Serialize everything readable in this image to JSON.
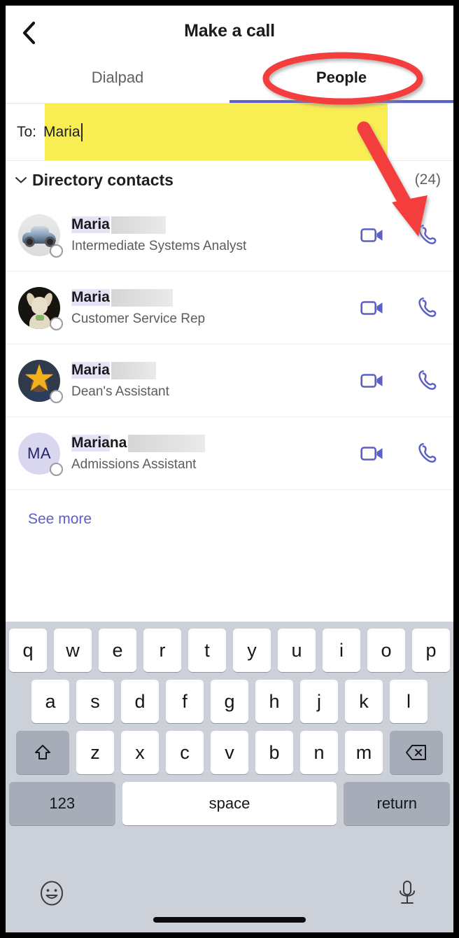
{
  "header": {
    "title": "Make a call",
    "back_icon": "chevron-left-icon"
  },
  "tabs": [
    {
      "label": "Dialpad",
      "active": false
    },
    {
      "label": "People",
      "active": true
    }
  ],
  "to_field": {
    "label": "To:",
    "value": "Maria",
    "highlight_color": "#f9ed54"
  },
  "section": {
    "title": "Directory contacts",
    "count": "(24)",
    "chevron_icon": "chevron-down-icon"
  },
  "contacts": [
    {
      "name_match": "Maria",
      "name_rest": "",
      "redacted_width": 78,
      "job_title": "Intermediate Systems Analyst",
      "avatar_type": "photo-car",
      "avatar_initials": "",
      "video_icon": "video-camera-icon",
      "call_icon": "phone-handset-icon"
    },
    {
      "name_match": "Maria",
      "name_rest": "",
      "redacted_width": 88,
      "job_title": "Customer Service Rep",
      "avatar_type": "photo-dog",
      "avatar_initials": "",
      "video_icon": "video-camera-icon",
      "call_icon": "phone-handset-icon"
    },
    {
      "name_match": "Maria",
      "name_rest": "",
      "redacted_width": 64,
      "job_title": "Dean's Assistant",
      "avatar_type": "photo-star",
      "avatar_initials": "",
      "video_icon": "video-camera-icon",
      "call_icon": "phone-handset-icon"
    },
    {
      "name_match": "Maria",
      "name_rest": "na",
      "redacted_width": 110,
      "job_title": "Admissions Assistant",
      "avatar_type": "initials",
      "avatar_initials": "MA",
      "video_icon": "video-camera-icon",
      "call_icon": "phone-handset-icon"
    }
  ],
  "see_more": "See more",
  "keyboard": {
    "row1": [
      "q",
      "w",
      "e",
      "r",
      "t",
      "y",
      "u",
      "i",
      "o",
      "p"
    ],
    "row2": [
      "a",
      "s",
      "d",
      "f",
      "g",
      "h",
      "j",
      "k",
      "l"
    ],
    "row3": [
      "z",
      "x",
      "c",
      "v",
      "b",
      "n",
      "m"
    ],
    "shift_icon": "shift-arrow-icon",
    "backspace_icon": "backspace-icon",
    "numbers_label": "123",
    "space_label": "space",
    "return_label": "return",
    "emoji_icon": "smiley-face-icon",
    "dictation_icon": "microphone-icon"
  },
  "annotations": {
    "ellipse_target": "People",
    "arrow_target": "call-button-first-contact",
    "color": "#f43e3e"
  },
  "colors": {
    "accent": "#5b5fc7",
    "highlight": "#f9ed54",
    "match_highlight": "#e5e4f7",
    "annotation_red": "#f43e3e",
    "keyboard_bg": "#ccd0d8"
  }
}
